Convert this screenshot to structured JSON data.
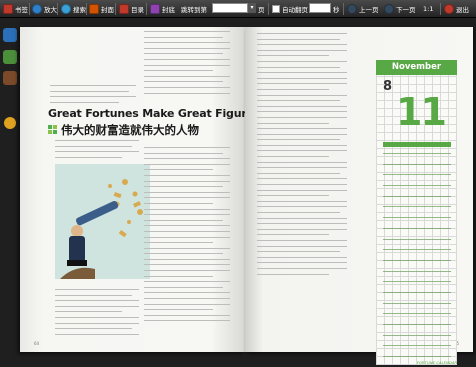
{
  "toolbar": {
    "bookmark_label": "书签",
    "zoomin_label": "放大",
    "search_label": "搜索",
    "cover_label": "封面",
    "toc_label": "目录",
    "backcover_label": "封底",
    "goto_label": "跳转到第",
    "goto_suffix": "页",
    "autoflip_label": "自动翻页",
    "seconds_suffix": "秒",
    "prev_label": "上一页",
    "next_label": "下一页",
    "ratio_label": "1:1",
    "exit_label": "退出"
  },
  "article": {
    "title_en": "Great Fortunes Make Great Figures",
    "title_cn": "伟大的财富造就伟大的人物",
    "page_left": "64",
    "page_right": "65"
  },
  "calendar": {
    "month": "November",
    "day_small": "8",
    "day_big": "11",
    "footer": "FORTUNE CALENDAR"
  }
}
